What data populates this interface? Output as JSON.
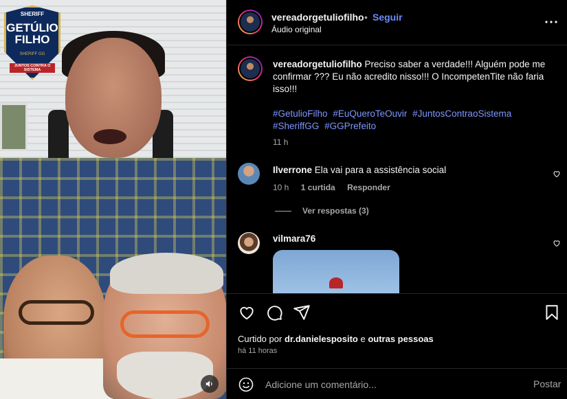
{
  "media": {
    "logo": {
      "top": "SHERIFF",
      "name": "GETÚLIO FILHO",
      "sub": "SHERIFF GG",
      "band": "JUNTOS CONTRA O SISTEMA"
    },
    "sound_icon": "speaker-icon"
  },
  "post": {
    "username": "vereadorgetuliofilho",
    "separator": "•",
    "follow_label": "Seguir",
    "audio_label": "Áudio original",
    "caption_user": "vereadorgetuliofilho",
    "caption_text": "Preciso saber a verdade!!! Alguém pode me confirmar ??? Eu não acredito nisso!!! O IncompetenTite não faria isso!!!",
    "hashtags": [
      "#GetulioFilho",
      "#EuQueroTeOuvir",
      "#JuntosContraoSistema",
      "#SheriffGG",
      "#GGPrefeito"
    ],
    "caption_time": "11 h"
  },
  "comments": [
    {
      "username": "Ilverrone",
      "text": "Ela vai para a assistência social",
      "time": "10 h",
      "likes": "1 curtida",
      "reply_label": "Responder",
      "view_replies": "Ver respostas (3)"
    },
    {
      "username": "vilmara76"
    }
  ],
  "actions": {
    "liked_by_prefix": "Curtido por",
    "liked_by_user": "dr.danielesposito",
    "liked_by_conj": "e",
    "liked_by_others": "outras pessoas",
    "post_time": "há 11 horas"
  },
  "comment_box": {
    "placeholder": "Adicione um comentário...",
    "post_label": "Postar"
  },
  "colors": {
    "background": "#000000",
    "text": "#f5f5f5",
    "secondary": "#a8a8a8",
    "link": "#6b8cff",
    "hashtag": "#7e97ff",
    "divider": "#262626"
  }
}
